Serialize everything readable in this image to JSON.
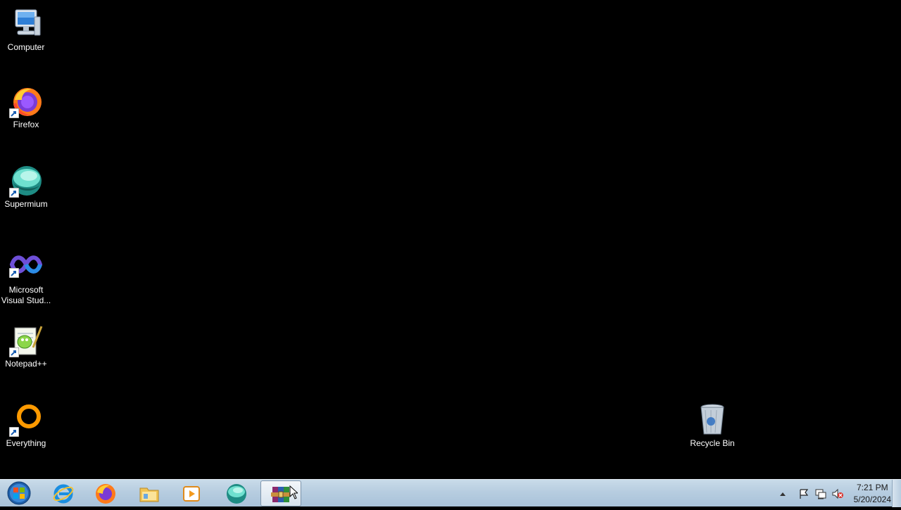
{
  "desktop": {
    "icons": [
      {
        "label": "Computer",
        "icon": "computer-icon"
      },
      {
        "label": "Firefox",
        "icon": "firefox-icon"
      },
      {
        "label": "Supermium",
        "icon": "supermium-icon"
      },
      {
        "label": "Microsoft Visual Stud...",
        "icon": "visual-studio-icon"
      },
      {
        "label": "Notepad++",
        "icon": "notepadpp-icon"
      },
      {
        "label": "Everything",
        "icon": "everything-icon"
      },
      {
        "label": "Recycle Bin",
        "icon": "recycle-bin-icon"
      }
    ]
  },
  "taskbar": {
    "start": "start-orb-icon",
    "pinned": [
      {
        "icon": "internet-explorer-icon"
      },
      {
        "icon": "firefox-icon"
      },
      {
        "icon": "file-explorer-icon"
      },
      {
        "icon": "media-player-icon"
      },
      {
        "icon": "supermium-icon"
      },
      {
        "icon": "winrar-icon",
        "active": true
      }
    ],
    "tray": [
      "show-hidden-icons-icon",
      "action-center-flag-icon",
      "network-icon",
      "volume-muted-icon"
    ],
    "clock": {
      "time": "7:21 PM",
      "date": "5/20/2024"
    }
  },
  "colors": {
    "desktop_bg": "#000000",
    "taskbar_bg": "#b7cde0"
  }
}
